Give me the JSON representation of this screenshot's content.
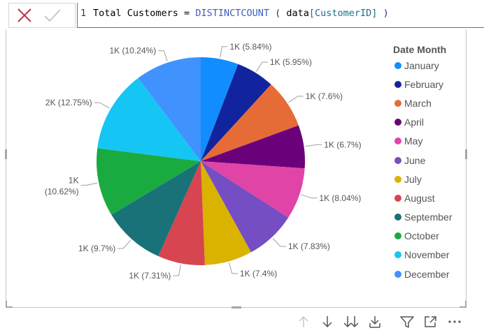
{
  "formula": {
    "line_number": "1",
    "tokens": [
      {
        "text": "Total Customers = ",
        "kind": "plain"
      },
      {
        "text": "DISTINCTCOUNT",
        "kind": "func"
      },
      {
        "text": " ( ",
        "kind": "paren"
      },
      {
        "text": "data",
        "kind": "plain"
      },
      {
        "text": "[CustomerID]",
        "kind": "ref"
      },
      {
        "text": " )",
        "kind": "paren"
      }
    ],
    "cancel_icon": "close-icon",
    "commit_icon": "checkmark-icon"
  },
  "chart_data": {
    "type": "pie",
    "legend_title": "Date Month",
    "legend_position": "right",
    "slices": [
      {
        "name": "January",
        "percent": 5.84,
        "label": "1K (5.84%)",
        "color": "#118dff"
      },
      {
        "name": "February",
        "percent": 5.95,
        "label": "1K (5.95%)",
        "color": "#12239e"
      },
      {
        "name": "March",
        "percent": 7.6,
        "label": "1K (7.6%)",
        "color": "#e66c37"
      },
      {
        "name": "April",
        "percent": 6.7,
        "label": "1K (6.7%)",
        "color": "#6b007b"
      },
      {
        "name": "May",
        "percent": 8.04,
        "label": "1K (8.04%)",
        "color": "#e044a7"
      },
      {
        "name": "June",
        "percent": 7.83,
        "label": "1K (7.83%)",
        "color": "#744ec2"
      },
      {
        "name": "July",
        "percent": 7.4,
        "label": "1K (7.4%)",
        "color": "#d9b300"
      },
      {
        "name": "August",
        "percent": 7.31,
        "label": "1K (7.31%)",
        "color": "#d64550"
      },
      {
        "name": "September",
        "percent": 9.7,
        "label": "1K (9.7%)",
        "color": "#197278"
      },
      {
        "name": "October",
        "percent": 10.62,
        "label": "1K (10.62%)",
        "color": "#1aab40"
      },
      {
        "name": "November",
        "percent": 12.75,
        "label": "2K (12.75%)",
        "color": "#15c6f4"
      },
      {
        "name": "December",
        "percent": 10.24,
        "label": "1K (10.24%)",
        "color": "#4092ff"
      }
    ]
  },
  "toolbar": {
    "buttons": [
      {
        "icon": "drill-up-arrow-icon",
        "enabled": false
      },
      {
        "icon": "drill-down-arrow-icon",
        "enabled": true
      },
      {
        "icon": "go-to-next-level-icon",
        "enabled": true
      },
      {
        "icon": "expand-hierarchy-icon",
        "enabled": true
      },
      {
        "icon": "filter-icon",
        "enabled": true
      },
      {
        "icon": "focus-mode-icon",
        "enabled": true
      },
      {
        "icon": "more-options-icon",
        "enabled": true
      }
    ]
  }
}
